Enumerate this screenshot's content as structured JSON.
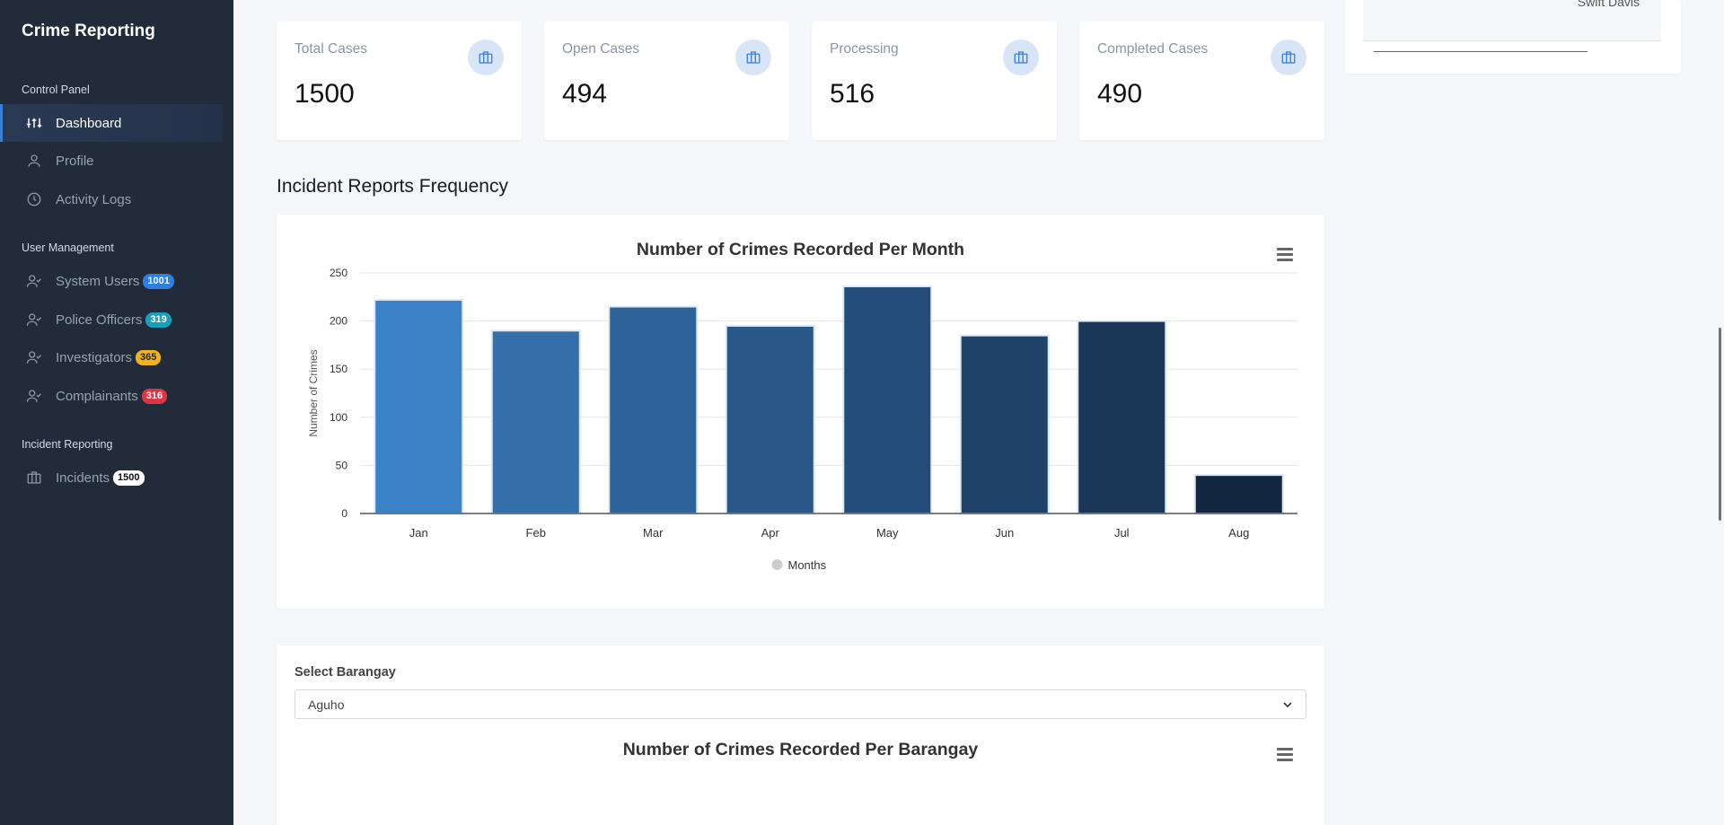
{
  "brand": "Crime Reporting",
  "sidebar": {
    "sections": [
      {
        "heading": "Control Panel",
        "items": [
          {
            "label": "Dashboard",
            "icon": "sliders-icon",
            "active": true
          },
          {
            "label": "Profile",
            "icon": "user-icon"
          },
          {
            "label": "Activity Logs",
            "icon": "clock-icon"
          }
        ]
      },
      {
        "heading": "User Management",
        "items": [
          {
            "label": "System Users",
            "icon": "user-check-icon",
            "badge": "1001",
            "badge_color": "#2f7fe0"
          },
          {
            "label": "Police Officers",
            "icon": "user-check-icon",
            "badge": "319",
            "badge_color": "#1a9fb8"
          },
          {
            "label": "Investigators",
            "icon": "user-check-icon",
            "badge": "365",
            "badge_color": "#f2b41c"
          },
          {
            "label": "Complainants",
            "icon": "user-check-icon",
            "badge": "316",
            "badge_color": "#dc3545"
          }
        ]
      },
      {
        "heading": "Incident Reporting",
        "items": [
          {
            "label": "Incidents",
            "icon": "briefcase-icon",
            "badge": "1500",
            "badge_color": "#ffffff"
          }
        ]
      }
    ]
  },
  "stats": [
    {
      "title": "Total Cases",
      "value": "1500"
    },
    {
      "title": "Open Cases",
      "value": "494"
    },
    {
      "title": "Processing",
      "value": "516"
    },
    {
      "title": "Completed Cases",
      "value": "490"
    }
  ],
  "right_panel": {
    "partial_name": "Swift Davis"
  },
  "section_title": "Incident Reports Frequency",
  "chart_data": {
    "type": "bar",
    "title": "Number of Crimes Recorded Per Month",
    "xlabel": "",
    "ylabel": "Number of Crimes",
    "categories": [
      "Jan",
      "Feb",
      "Mar",
      "Apr",
      "May",
      "Jun",
      "Jul",
      "Aug"
    ],
    "series": [
      {
        "name": "Months",
        "values": [
          222,
          190,
          215,
          195,
          236,
          185,
          200,
          40
        ]
      }
    ],
    "colors": [
      "#3a81c5",
      "#346fa9",
      "#2e6399",
      "#285788",
      "#234c78",
      "#1f4268",
      "#1a3757",
      "#132740"
    ],
    "ylim": [
      0,
      250
    ],
    "yticks": [
      "0",
      "50",
      "100",
      "150",
      "200",
      "250"
    ],
    "grid": true,
    "legend": "bottom"
  },
  "barangay": {
    "label": "Select Barangay",
    "selected": "Aguho",
    "chart_title": "Number of Crimes Recorded Per Barangay"
  }
}
